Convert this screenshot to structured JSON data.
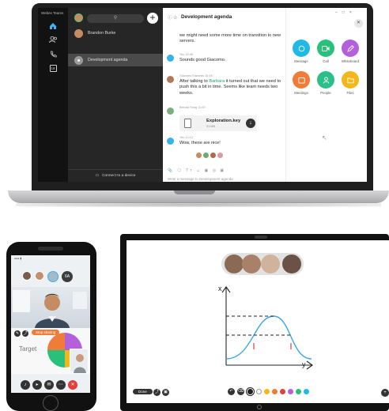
{
  "laptop": {
    "rail": {
      "title": "Webex Teams",
      "icons": [
        "home-icon",
        "people-icon",
        "phone-icon",
        "calendar-icon"
      ],
      "calendar_day": "18"
    },
    "sidebar": {
      "search_icon": "search-icon",
      "add_label": "+",
      "contacts": [
        {
          "name": "Brandon Burke",
          "avatar_color": "#c58c63"
        },
        {
          "name": "Development agenda",
          "avatar_color": "#9a9a9a",
          "active": true
        }
      ],
      "connect_label": "Connect to a device"
    },
    "chat": {
      "title": "Development agenda",
      "messages": [
        {
          "meta": "",
          "text": "we might need some more time on transition to new servers.",
          "avatar_color": ""
        },
        {
          "meta": "You 10:46",
          "text": "Sounds good Giacomo.",
          "avatar_color": "#36b4e6"
        },
        {
          "meta": "Giacomo Edwards 10:48",
          "text_before": "After talking to ",
          "highlight": "Barbara",
          "text_after": " it turned out that we need to push this a bit in time. Seems like team needs two weeks.",
          "avatar_color": "#b07a5a"
        },
        {
          "meta": "Brenda Song 11:00",
          "avatar_color": "#7ab07a"
        },
        {
          "meta": "You 12:12",
          "text": "Wow, these are nice!",
          "avatar_color": "#36b4e6"
        }
      ],
      "file": {
        "name": "Exploration.key",
        "size": "31 MB"
      },
      "reactions": [
        "#c88a62",
        "#74a86e",
        "#b06a4a",
        "#d99aa0"
      ],
      "composer_tools": "📎 🗨 Tт ☺ ▣ ◎ ▣",
      "composer_placeholder": "Write a message to Development agenda"
    },
    "actions": [
      {
        "label": "Message",
        "color": "#20b8e6",
        "icon": "message-icon"
      },
      {
        "label": "Call",
        "color": "#2bc07a",
        "icon": "video-call-icon"
      },
      {
        "label": "Whiteboard",
        "color": "#b45fdc",
        "icon": "whiteboard-icon"
      },
      {
        "label": "Meetings",
        "color": "#f07c3a",
        "icon": "meetings-icon"
      },
      {
        "label": "People",
        "color": "#2bbf8a",
        "icon": "people-icon"
      },
      {
        "label": "Files",
        "color": "#f2b81a",
        "icon": "files-icon"
      }
    ],
    "window_controls": [
      "–",
      "□",
      "×"
    ]
  },
  "phone": {
    "participants_count": "6A",
    "stop_sharing_label": "Stop sharing",
    "shared_label": "Target",
    "controls": [
      "mic-icon",
      "video-icon",
      "chat-icon",
      "more-icon",
      "end-call-icon"
    ]
  },
  "board": {
    "axis_x_label": "y",
    "axis_y_label": "x",
    "done_label": "Done",
    "palette": [
      "#222222",
      "#ffffff",
      "#f2b81a",
      "#f07c3a",
      "#e0413a",
      "#b45fdc",
      "#2bc07a",
      "#20b8e6"
    ]
  }
}
